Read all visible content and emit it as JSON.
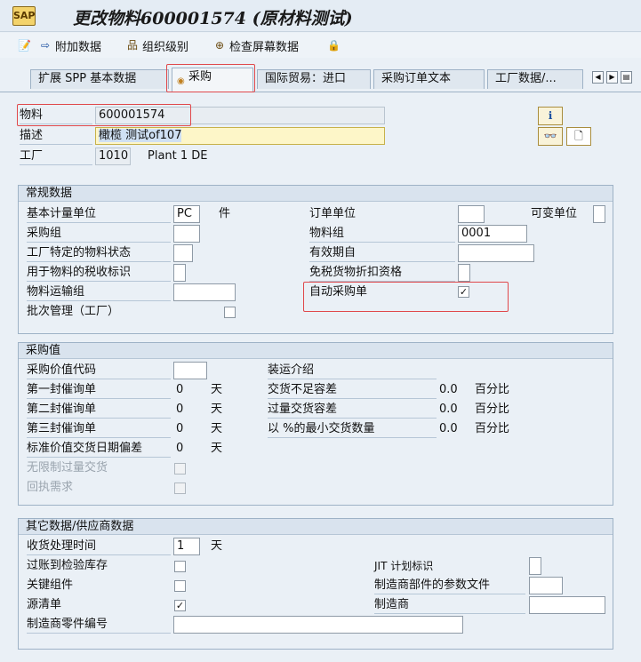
{
  "window": {
    "title": "更改物料600001574 (原材料测试)",
    "title_icon": "SAP"
  },
  "toolbar": {
    "additional_data": "附加数据",
    "org_levels": "组织级别",
    "check_screens": "检查屏幕数据"
  },
  "tabs": [
    {
      "label": "扩展 SPP 基本数据"
    },
    {
      "label": "采购"
    },
    {
      "label": "国际贸易：进口"
    },
    {
      "label": "采购订单文本"
    },
    {
      "label": "工厂数据/..."
    }
  ],
  "header": {
    "material_label": "物料",
    "material_value": "600001574",
    "desc_label": "描述",
    "desc_value": "橄榄 测试of107",
    "plant_label": "工厂",
    "plant_value": "1010",
    "plant_name": "Plant 1 DE"
  },
  "general": {
    "title": "常规数据",
    "base_uom_label": "基本计量单位",
    "base_uom_value": "PC",
    "base_uom_text": "件",
    "order_unit_label": "订单单位",
    "var_unit_label": "可变单位",
    "purch_group_label": "采购组",
    "mat_group_label": "物料组",
    "mat_group_value": "0001",
    "plant_status_label": "工厂特定的物料状态",
    "valid_from_label": "有效期自",
    "tax_label": "用于物料的税收标识",
    "cash_disc_label": "免税货物折扣资格",
    "transport_group_label": "物料运输组",
    "auto_po_label": "自动采购单",
    "auto_po_checked": "✓",
    "batch_label": "批次管理（工厂）"
  },
  "purchasing_values": {
    "title": "采购值",
    "pv_key_label": "采购价值代码",
    "shipping_instr_label": "装运介绍",
    "rem1_label": "第一封催询单",
    "rem1_value": "0",
    "rem1_unit": "天",
    "underdel_label": "交货不足容差",
    "underdel_value": "0.0",
    "underdel_unit": "百分比",
    "rem2_label": "第二封催询单",
    "rem2_value": "0",
    "rem2_unit": "天",
    "overdel_label": "过量交货容差",
    "overdel_value": "0.0",
    "overdel_unit": "百分比",
    "rem3_label": "第三封催询单",
    "rem3_value": "0",
    "rem3_unit": "天",
    "minqty_label": "以 %的最小交货数量",
    "minqty_value": "0.0",
    "minqty_unit": "百分比",
    "stddev_label": "标准价值交货日期偏差",
    "stddev_value": "0",
    "stddev_unit": "天",
    "unlimited_label": "无限制过量交货",
    "ack_label": "回执需求"
  },
  "other": {
    "title": "其它数据/供应商数据",
    "gr_time_label": "收货处理时间",
    "gr_time_value": "1",
    "gr_time_unit": "天",
    "post_insp_label": "过账到检验库存",
    "jit_label": "JIT 计划标识",
    "critical_label": "关键组件",
    "mpn_profile_label": "制造商部件的参数文件",
    "source_list_label": "源清单",
    "source_list_checked": "✓",
    "manufacturer_label": "制造商",
    "mpn_label": "制造商零件编号"
  }
}
